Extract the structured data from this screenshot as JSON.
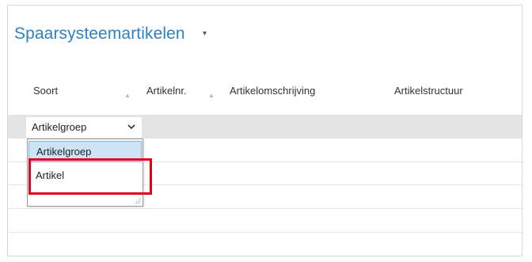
{
  "page": {
    "title": "Spaarsysteemartikelen",
    "title_menu_icon": "caret-down-icon"
  },
  "table": {
    "columns": [
      {
        "label": "Soort",
        "sort_icon": "sort-up-icon"
      },
      {
        "label": "Artikelnr.",
        "sort_icon": "sort-up-icon"
      },
      {
        "label": "Artikelomschrijving"
      },
      {
        "label": "Artikelstructuur"
      }
    ],
    "filter": {
      "soort_value": "Artikelgroep",
      "chevron_icon": "chevron-down-icon"
    }
  },
  "dropdown": {
    "options": [
      {
        "label": "Artikelgroep",
        "state": "hovered"
      },
      {
        "label": "Artikel",
        "state": "annotated"
      }
    ],
    "resize_icon": "resize-grip-icon"
  },
  "colors": {
    "title": "#2b82c4",
    "filter_row": "#e4e4e4",
    "option_hover": "#cde4f7",
    "annotation": "#e3001b"
  }
}
